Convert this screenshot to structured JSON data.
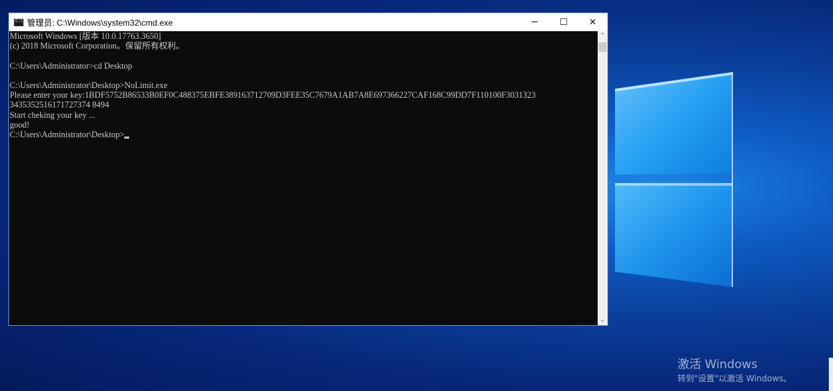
{
  "window": {
    "title": "管理员: C:\\Windows\\system32\\cmd.exe",
    "app_icon": "cmd-icon",
    "controls": {
      "minimize": "─",
      "maximize": "☐",
      "close": "✕"
    }
  },
  "console": {
    "lines": [
      "Microsoft Windows [版本 10.0.17763.3650]",
      "(c) 2018 Microsoft Corporation。保留所有权利。",
      "",
      "C:\\Users\\Administrator>cd Desktop",
      "",
      "C:\\Users\\Administrator\\Desktop>NoLimit.exe",
      "Please enter your key:1BDF5752B86533B0EF0C488375EBFE389163712709D3FEE35C7679A1AB7A8E697366227CAF168C99DD7F110100F3031323",
      "3435352516171727374 8494",
      "Start cheking your key ...",
      "good!"
    ],
    "prompt": "C:\\Users\\Administrator\\Desktop>"
  },
  "scrollbar": {
    "up": "⌃",
    "down": "⌄"
  },
  "watermark": {
    "title": "激活 Windows",
    "subtitle": "转到\"设置\"以激活 Windows。"
  },
  "colors": {
    "console_bg": "#0c0c0c",
    "console_text": "#c8c8c8",
    "desktop_blue": "#0a3f9a"
  }
}
